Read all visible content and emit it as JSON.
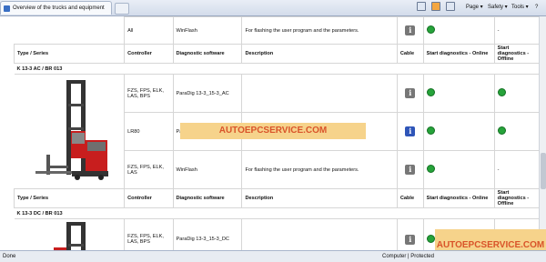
{
  "browser": {
    "tab_title": "Overview of the trucks and equipment",
    "commands": {
      "page": "Page",
      "safety": "Safety",
      "tools": "Tools"
    }
  },
  "headers": {
    "type_series": "Type / Series",
    "controller": "Controller",
    "diagnostic_software": "Diagnostic software",
    "description": "Description",
    "cable": "Cable",
    "start_online": "Start diagnostics - Online",
    "start_offline": "Start diagnostics - Offline"
  },
  "top_row": {
    "controller": "All",
    "software": "WinFlash",
    "description": "For flashing the user program and the parameters.",
    "offline": "-"
  },
  "section1": {
    "series": "K 13-3 AC / BR 013",
    "rows": [
      {
        "controller": "FZS, FPS, ELK, LAS, BPS",
        "software": "ParaDig 13-3_15-3_AC",
        "description": "",
        "offline": ""
      },
      {
        "controller": "LR80",
        "software": "ParaDig LR80",
        "description": "Steering system Lenze (LR80)",
        "offline": ""
      },
      {
        "controller": "FZS, FPS, ELK, LAS",
        "software": "WinFlash",
        "description": "For flashing the user program and the parameters.",
        "offline": "-"
      }
    ]
  },
  "section2": {
    "series": "K 13-3 DC / BR 013",
    "rows": [
      {
        "controller": "FZS, FPS, ELK, LAS, BPS",
        "software": "ParaDig 13-3_15-3_DC",
        "description": "",
        "offline": ""
      }
    ]
  },
  "status": {
    "left": "Done",
    "zone": "Computer | Protected"
  },
  "watermarks": [
    "AUTOEPCSERVICE.COM",
    "AUTOEPCSERVICE.COM"
  ]
}
